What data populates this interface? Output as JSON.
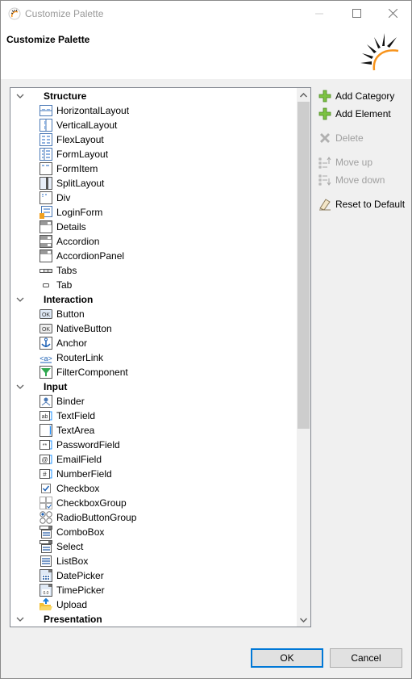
{
  "window": {
    "title": "Customize Palette",
    "controls": {
      "minimize": "—",
      "maximize": "☐",
      "close": "✕"
    }
  },
  "header": {
    "title": "Customize Palette"
  },
  "tree": {
    "categories": [
      {
        "label": "Structure",
        "expanded": true,
        "items": [
          {
            "label": "HorizontalLayout",
            "icon": "horizontal-layout-icon"
          },
          {
            "label": "VerticalLayout",
            "icon": "vertical-layout-icon"
          },
          {
            "label": "FlexLayout",
            "icon": "flex-layout-icon"
          },
          {
            "label": "FormLayout",
            "icon": "form-layout-icon"
          },
          {
            "label": "FormItem",
            "icon": "form-item-icon"
          },
          {
            "label": "SplitLayout",
            "icon": "split-layout-icon"
          },
          {
            "label": "Div",
            "icon": "div-icon"
          },
          {
            "label": "LoginForm",
            "icon": "login-form-icon"
          },
          {
            "label": "Details",
            "icon": "details-icon"
          },
          {
            "label": "Accordion",
            "icon": "accordion-icon"
          },
          {
            "label": "AccordionPanel",
            "icon": "accordion-panel-icon"
          },
          {
            "label": "Tabs",
            "icon": "tabs-icon"
          },
          {
            "label": "Tab",
            "icon": "tab-icon"
          }
        ]
      },
      {
        "label": "Interaction",
        "expanded": true,
        "items": [
          {
            "label": "Button",
            "icon": "button-icon"
          },
          {
            "label": "NativeButton",
            "icon": "native-button-icon"
          },
          {
            "label": "Anchor",
            "icon": "anchor-icon"
          },
          {
            "label": "RouterLink",
            "icon": "router-link-icon"
          },
          {
            "label": "FilterComponent",
            "icon": "filter-icon"
          }
        ]
      },
      {
        "label": "Input",
        "expanded": true,
        "items": [
          {
            "label": "Binder",
            "icon": "binder-icon"
          },
          {
            "label": "TextField",
            "icon": "text-field-icon"
          },
          {
            "label": "TextArea",
            "icon": "text-area-icon"
          },
          {
            "label": "PasswordField",
            "icon": "password-field-icon"
          },
          {
            "label": "EmailField",
            "icon": "email-field-icon"
          },
          {
            "label": "NumberField",
            "icon": "number-field-icon"
          },
          {
            "label": "Checkbox",
            "icon": "checkbox-icon"
          },
          {
            "label": "CheckboxGroup",
            "icon": "checkbox-group-icon"
          },
          {
            "label": "RadioButtonGroup",
            "icon": "radio-button-group-icon"
          },
          {
            "label": "ComboBox",
            "icon": "combo-box-icon"
          },
          {
            "label": "Select",
            "icon": "select-icon"
          },
          {
            "label": "ListBox",
            "icon": "list-box-icon"
          },
          {
            "label": "DatePicker",
            "icon": "date-picker-icon"
          },
          {
            "label": "TimePicker",
            "icon": "time-picker-icon"
          },
          {
            "label": "Upload",
            "icon": "upload-icon"
          }
        ]
      },
      {
        "label": "Presentation",
        "expanded": true,
        "items": []
      }
    ],
    "scroll_position": 0.0
  },
  "side_actions": {
    "add_category": "Add Category",
    "add_element": "Add Element",
    "delete": "Delete",
    "move_up": "Move up",
    "move_down": "Move down",
    "reset": "Reset to Default"
  },
  "footer": {
    "ok": "OK",
    "cancel": "Cancel"
  },
  "colors": {
    "accent": "#0078d7",
    "add_green": "#5fb336",
    "logo_orange": "#f7941d"
  }
}
